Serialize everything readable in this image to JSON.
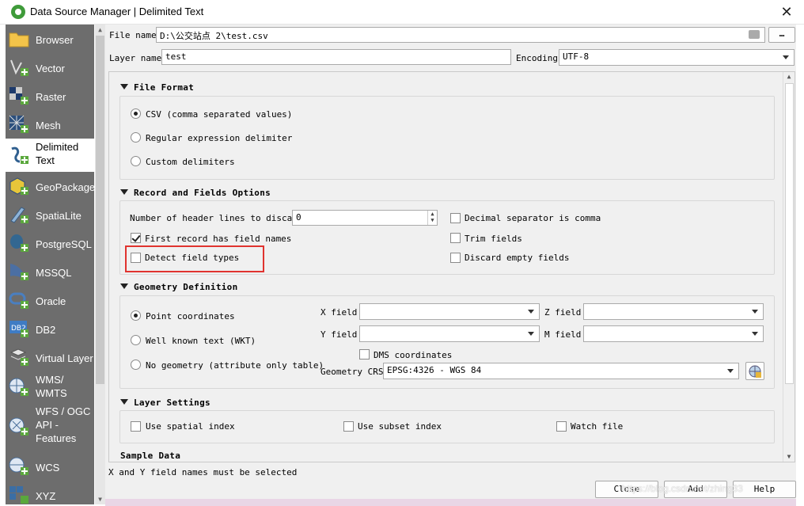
{
  "window": {
    "title": "Data Source Manager | Delimited Text",
    "close_glyph": "✕"
  },
  "sidebar": {
    "items": [
      {
        "label": "Browser",
        "icon": "folder-icon"
      },
      {
        "label": "Vector",
        "icon": "vector-layer-icon"
      },
      {
        "label": "Raster",
        "icon": "raster-layer-icon"
      },
      {
        "label": "Mesh",
        "icon": "mesh-layer-icon"
      },
      {
        "label": "Delimited\nText",
        "icon": "delimited-text-icon",
        "selected": true
      },
      {
        "label": "GeoPackage",
        "icon": "geopackage-icon"
      },
      {
        "label": "SpatiaLite",
        "icon": "spatialite-icon"
      },
      {
        "label": "PostgreSQL",
        "icon": "postgresql-icon"
      },
      {
        "label": "MSSQL",
        "icon": "mssql-icon"
      },
      {
        "label": "Oracle",
        "icon": "oracle-icon"
      },
      {
        "label": "DB2",
        "icon": "db2-icon"
      },
      {
        "label": "Virtual Layer",
        "icon": "virtual-layer-icon"
      },
      {
        "label": "WMS/\nWMTS",
        "icon": "wms-icon"
      },
      {
        "label": "WFS / OGC\nAPI -\nFeatures",
        "icon": "wfs-icon"
      },
      {
        "label": "WCS",
        "icon": "wcs-icon"
      },
      {
        "label": "XYZ",
        "icon": "xyz-icon"
      }
    ]
  },
  "file": {
    "name_label": "File name",
    "name_value": "D:\\公交站点 2\\test.csv",
    "browse_label": "…",
    "clear_glyph": "⌫"
  },
  "layer": {
    "name_label": "Layer name",
    "name_value": "test",
    "encoding_label": "Encoding",
    "encoding_value": "UTF-8"
  },
  "file_format": {
    "header": "File Format",
    "options": [
      "CSV (comma separated values)",
      "Regular expression delimiter",
      "Custom delimiters"
    ],
    "selected": 0
  },
  "record_fields": {
    "header": "Record and Fields Options",
    "header_lines_label": "Number of header lines to discard",
    "header_lines_value": "0",
    "first_record_label": "First record has field names",
    "first_record_checked": true,
    "detect_types_label": "Detect field types",
    "detect_types_checked": false,
    "decimal_comma_label": "Decimal separator is comma",
    "trim_fields_label": "Trim fields",
    "discard_empty_label": "Discard empty fields"
  },
  "geometry": {
    "header": "Geometry Definition",
    "options": [
      "Point coordinates",
      "Well known text (WKT)",
      "No geometry (attribute only table)"
    ],
    "selected": 0,
    "x_label": "X field",
    "y_label": "Y field",
    "z_label": "Z field",
    "m_label": "M field",
    "dms_label": "DMS coordinates",
    "crs_label": "Geometry CRS",
    "crs_value": "EPSG:4326 - WGS 84"
  },
  "layer_settings": {
    "header": "Layer Settings",
    "spatial_index_label": "Use spatial index",
    "subset_index_label": "Use subset index",
    "watch_file_label": "Watch file"
  },
  "sample_data": {
    "header": "Sample Data"
  },
  "status": {
    "message": "X and Y field names must be selected"
  },
  "buttons": {
    "close": "Close",
    "add": "Add",
    "help": "Help"
  },
  "watermark": "https://blog.csdn.net/zhing33",
  "colors": {
    "sidebar_bg": "#6d6d6d",
    "highlight_border": "#e0332f"
  }
}
